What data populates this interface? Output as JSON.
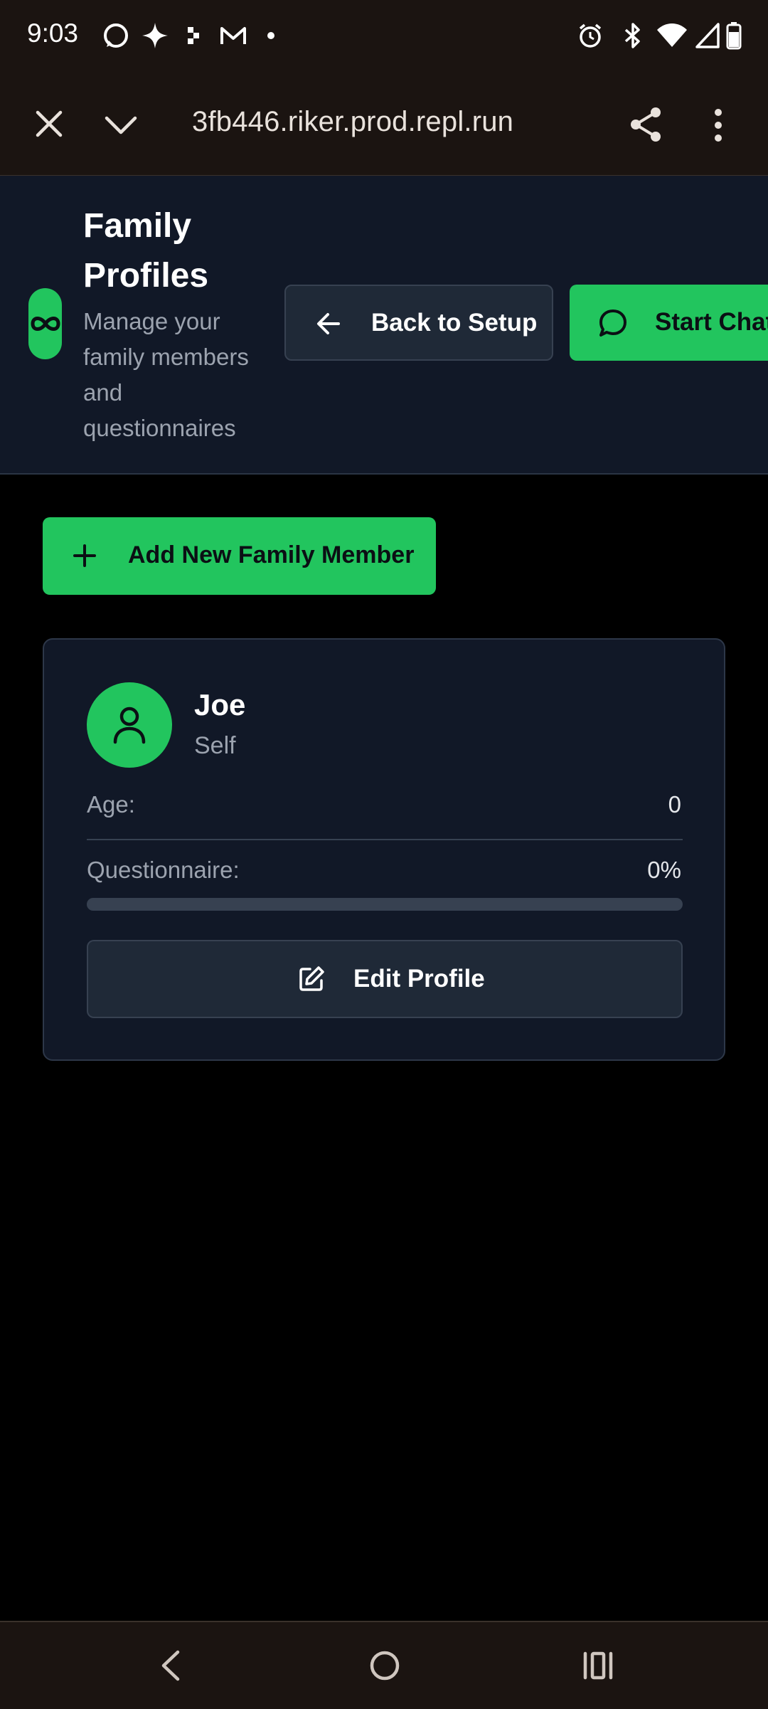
{
  "status_bar": {
    "time": "9:03",
    "left_icons": [
      "whatsapp-icon",
      "sparkle-icon",
      "app-icon",
      "gmail-icon",
      "dot-icon"
    ],
    "right_icons": [
      "alarm-icon",
      "bluetooth-icon",
      "wifi-icon",
      "signal-icon",
      "battery-icon"
    ]
  },
  "browser": {
    "url": "3fb446.riker.prod.repl.run",
    "close_icon": "close-icon",
    "collapse_icon": "chevron-down-icon",
    "share_icon": "share-icon",
    "menu_icon": "more-vert-icon"
  },
  "header": {
    "logo_glyph": "∞",
    "title": "Family Profiles",
    "subtitle": "Manage your family members and questionnaires",
    "back_button": "Back to Setup",
    "chat_button": "Start Chat"
  },
  "main": {
    "add_button": "Add New Family Member",
    "members": [
      {
        "name": "Joe",
        "relation": "Self",
        "age_label": "Age:",
        "age_value": "0",
        "questionnaire_label": "Questionnaire:",
        "questionnaire_value": "0%",
        "questionnaire_progress": 0,
        "edit_button": "Edit Profile"
      }
    ]
  },
  "nav_bar": [
    "back-nav-icon",
    "home-nav-icon",
    "recents-nav-icon"
  ],
  "colors": {
    "accent": "#22c55e",
    "header_bg": "#111827",
    "card_bg": "#111827",
    "page_bg": "#000000",
    "browser_chrome": "#1b1411"
  }
}
